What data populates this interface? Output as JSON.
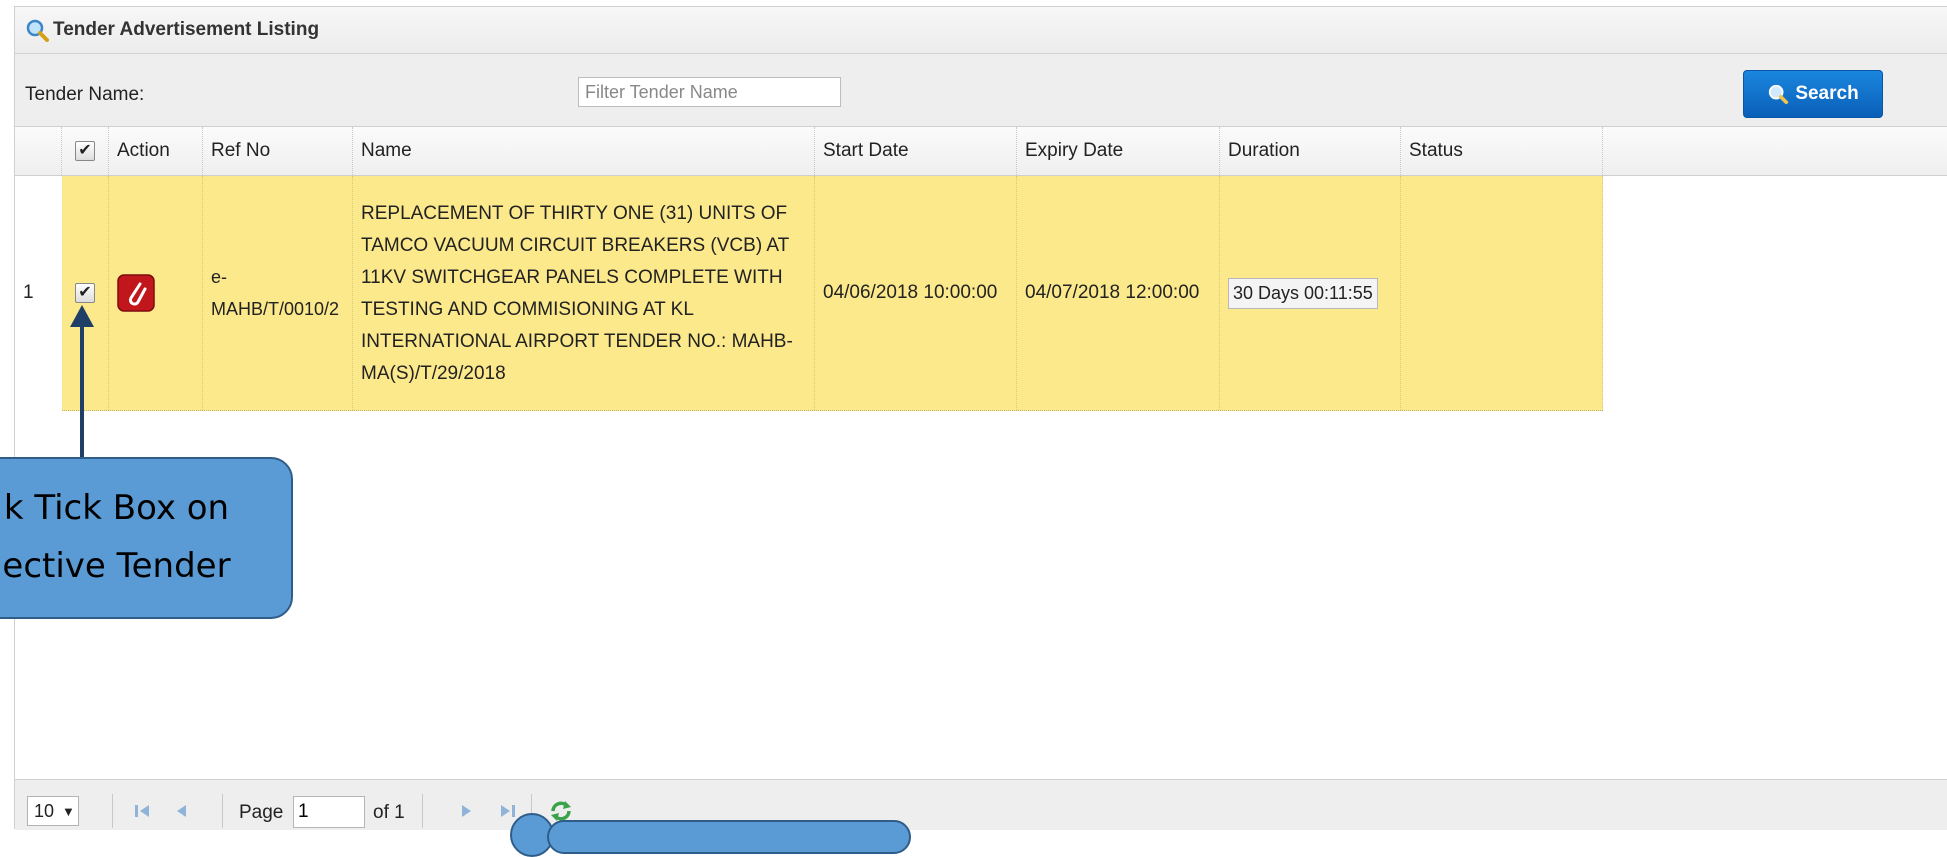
{
  "panel": {
    "title": "Tender Advertisement Listing"
  },
  "filter": {
    "label": "Tender Name:",
    "placeholder": "Filter Tender Name",
    "search_label": "Search"
  },
  "columns": [
    "Action",
    "Ref No",
    "Name",
    "Start Date",
    "Expiry Date",
    "Duration",
    "Status"
  ],
  "rows": [
    {
      "index": "1",
      "ref_no": "e-\nMAHB/T/0010/2",
      "name": "REPLACEMENT OF THIRTY ONE (31) UNITS OF TAMCO VACUUM CIRCUIT BREAKERS (VCB) AT 11KV SWITCHGEAR PANELS COMPLETE WITH TESTING AND COMMISIONING AT KL INTERNATIONAL AIRPORT TENDER NO.: MAHB-MA(S)/T/29/2018",
      "start_date": "04/06/2018 10:00:00",
      "expiry_date": "04/07/2018 12:00:00",
      "duration": "30 Days 00:11:55",
      "status": "",
      "checked": true
    }
  ],
  "pager": {
    "page_size": "10",
    "page_label": "Page",
    "page_value": "1",
    "of_label": "of 1"
  },
  "callout": {
    "line1": "k Tick Box on",
    "line2": "ective Tender"
  },
  "colors": {
    "row_highlight": "#fbe98c",
    "accent": "#0a5fb8",
    "callout": "#5b9bd5"
  }
}
